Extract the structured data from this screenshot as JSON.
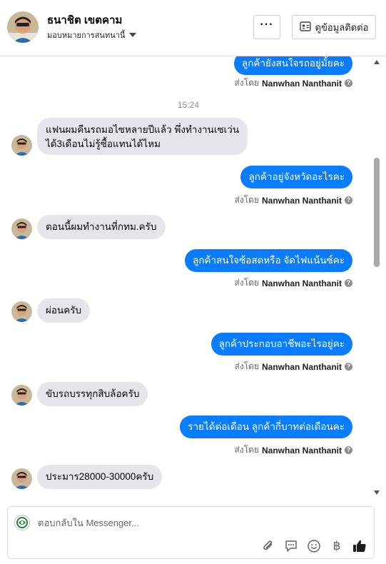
{
  "header": {
    "contact_name": "ธนาชิต เขตคาม",
    "assigned_label": "มอบหมายการสนทนานี้",
    "more_label": "···",
    "contact_button_label": "ดูข้อมูลติดต่อ"
  },
  "thread": {
    "timestamp": "15:24",
    "sent_by_prefix": "ส่งโดย",
    "sender_name": "Nanwhan Nanthanit",
    "messages": [
      {
        "direction": "out",
        "text": "ลูกค้ายังสนใจรถอยู่มั้ยคะ"
      },
      {
        "direction": "in",
        "lines": [
          "แฟนผมคืนรถมอไซหลายปีแล้ว พึ่งทำงานเซเว่น",
          "ได้3เดือนไม่รู้ซื้อแทนได้ไหม"
        ]
      },
      {
        "direction": "out",
        "text": "ลูกค้าอยู่จังหวัดอะไรคะ"
      },
      {
        "direction": "in",
        "text": "ตอนนี้ผมทำงานที่กทม.ครับ"
      },
      {
        "direction": "out",
        "text": "ลูกค้าสนใจซ้อสดหรือ จัดไฟแน้นซ์คะ"
      },
      {
        "direction": "in",
        "text": "ผ่อนครับ"
      },
      {
        "direction": "out",
        "text": "ลูกค้าประกอบอาชีพอะไรอยู่คะ"
      },
      {
        "direction": "in",
        "text": "ขับรถบรรทุกสิบล้อครับ"
      },
      {
        "direction": "out",
        "text": "รายได้ต่อเดือน ลูกค้ากี่บาทต่อเดือนคะ"
      },
      {
        "direction": "in",
        "text": "ประมาร28000-30000ครับ"
      }
    ]
  },
  "composer": {
    "placeholder": "ตอบกลับใน Messenger...",
    "baht_symbol": "฿"
  },
  "colors": {
    "outgoing_bubble": "#0a7cff",
    "incoming_bubble": "#e4e6eb",
    "muted_text": "#65676b"
  },
  "icons": [
    "more-icon",
    "contact-card-icon",
    "caret-down-icon",
    "info-icon",
    "attachment-icon",
    "saved-reply-icon",
    "emoji-icon",
    "baht-icon",
    "like-icon"
  ]
}
